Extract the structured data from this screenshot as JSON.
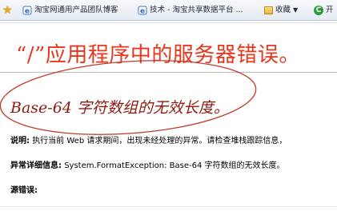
{
  "favorites_bar": {
    "items": [
      {
        "label": "淘宝网通用产品团队博客",
        "icon": "ie-page-icon"
      },
      {
        "label": "技术 - 淘宝共享数据平台 ...",
        "icon": "ie-page-icon"
      },
      {
        "label": "收藏",
        "icon": "folder-icon"
      },
      {
        "label": "开",
        "icon": "green-c-icon"
      }
    ]
  },
  "error_page": {
    "title": "“/”应用程序中的服务器错误。",
    "subtitle": "Base-64 字符数组的无效长度。",
    "description_label": "说明:",
    "description_text": "执行当前 Web 请求期间，出现未经处理的异常。请检查堆栈跟踪信息，",
    "exception_label": "异常详细信息:",
    "exception_text": "System.FormatException: Base-64 字符数组的无效长度。",
    "source_label": "源错误:"
  },
  "annotation": {
    "color": "#c0392b"
  }
}
